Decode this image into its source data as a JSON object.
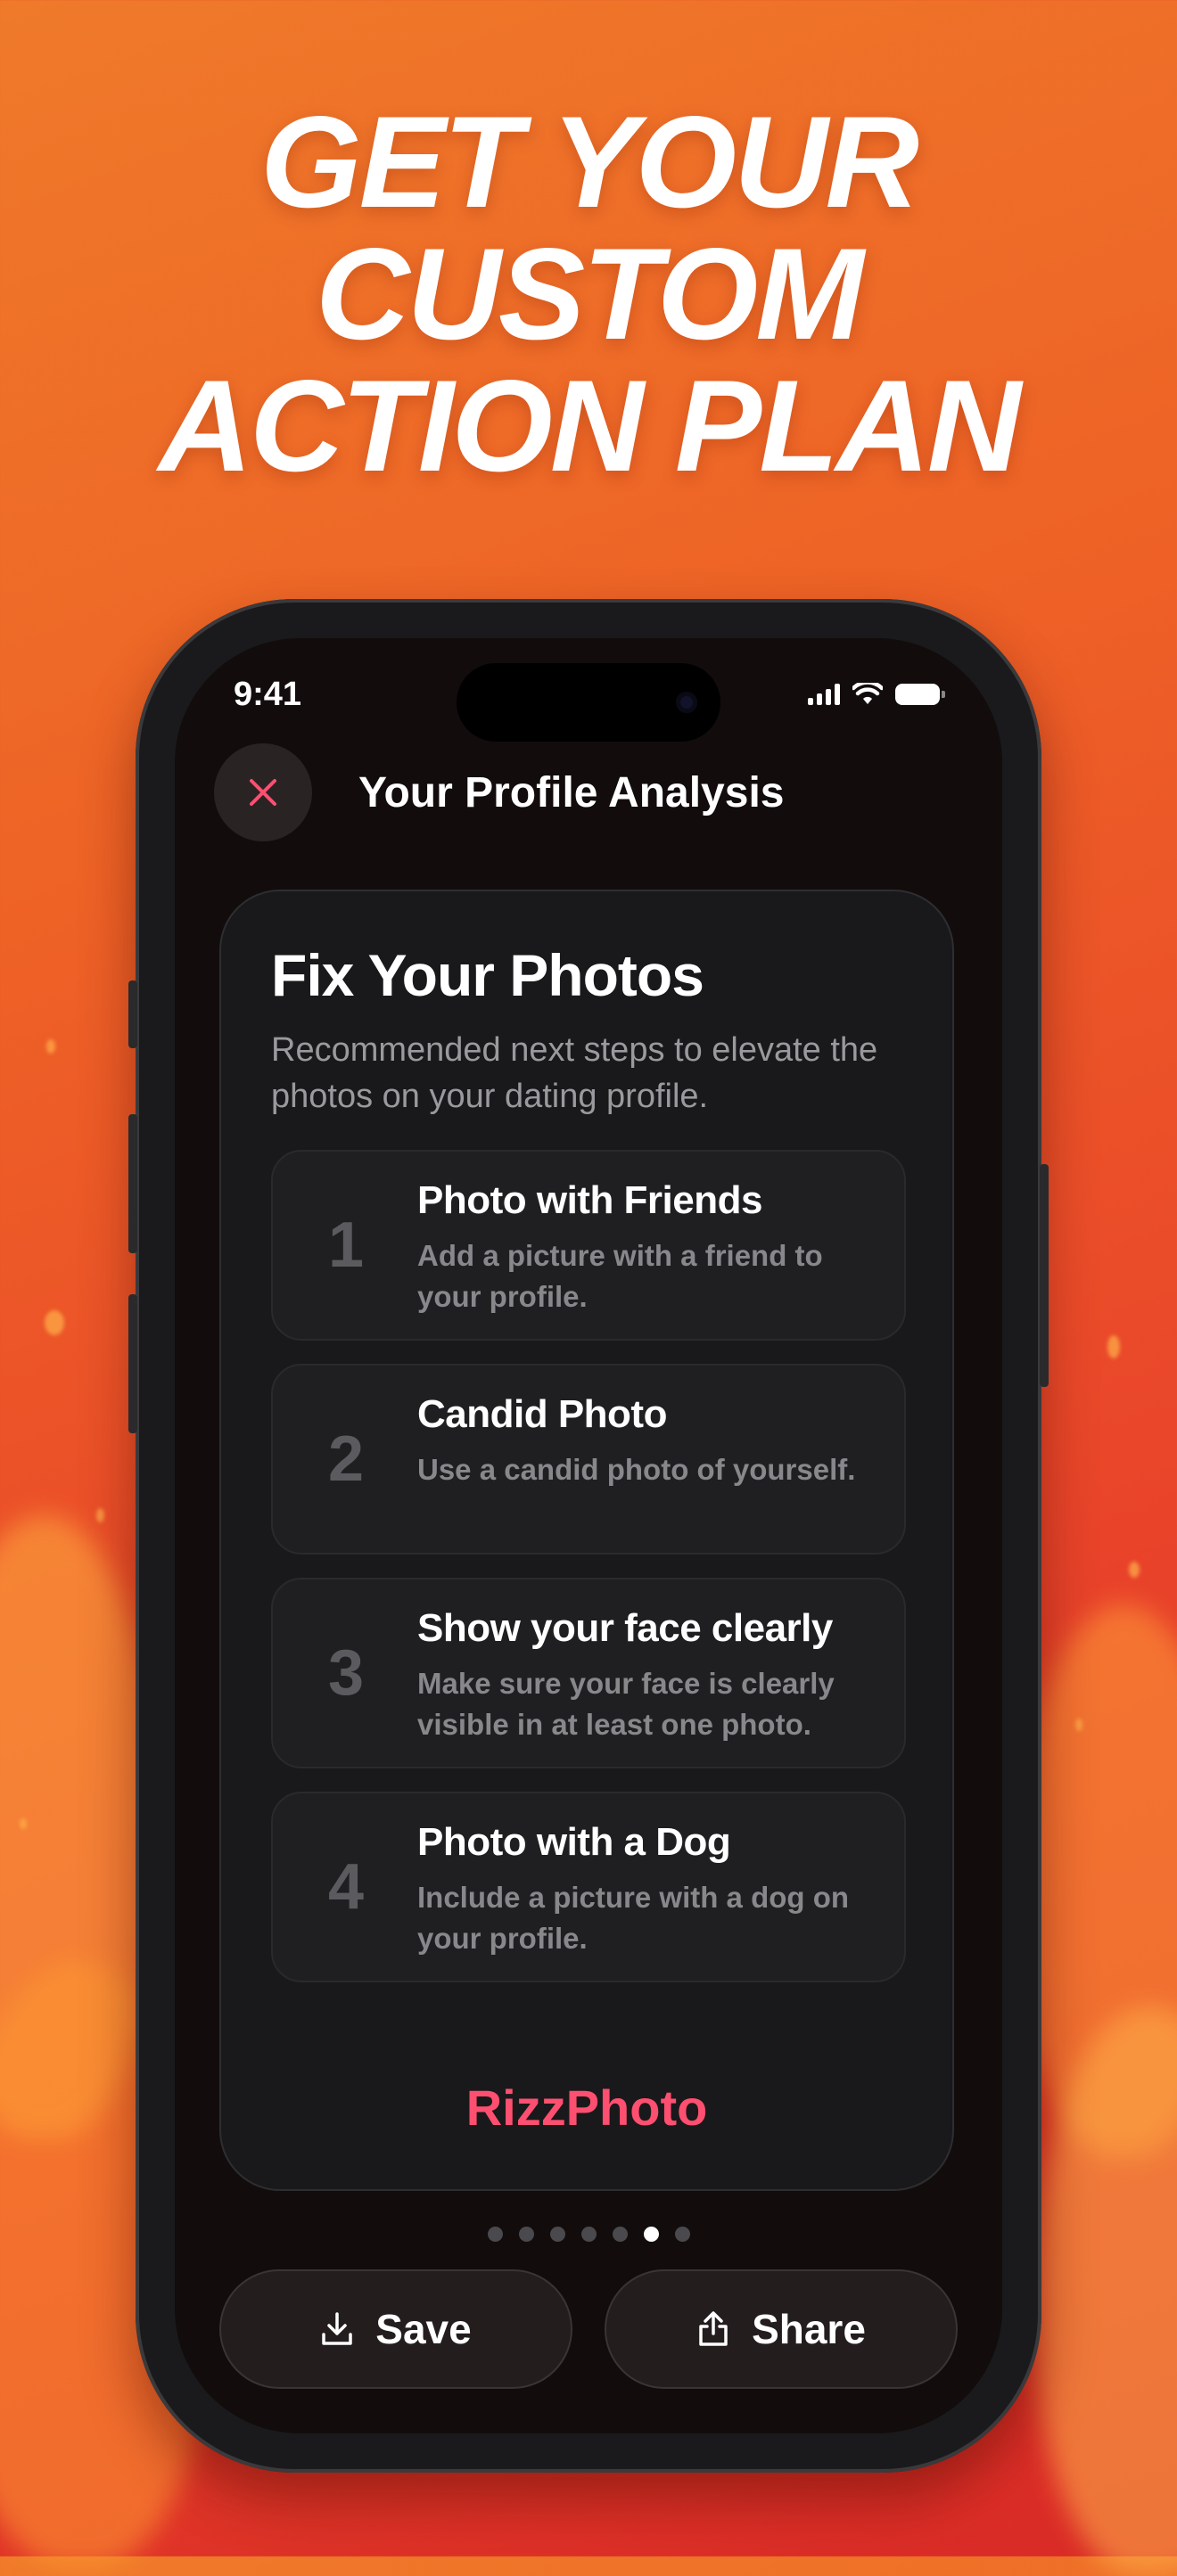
{
  "headline": {
    "line1": "GET YOUR",
    "line2": "CUSTOM",
    "line3": "ACTION PLAN"
  },
  "status_bar": {
    "time": "9:41"
  },
  "nav": {
    "title": "Your Profile Analysis",
    "close_icon": "close-icon"
  },
  "card": {
    "title": "Fix Your Photos",
    "subtitle": "Recommended next steps to elevate the photos on your dating profile.",
    "steps": [
      {
        "number": "1",
        "title": "Photo with Friends",
        "description": "Add a picture with a friend to your profile."
      },
      {
        "number": "2",
        "title": "Candid Photo",
        "description": "Use a candid photo of yourself."
      },
      {
        "number": "3",
        "title": "Show your face clearly",
        "description": "Make sure your face is clearly visible in at least one photo."
      },
      {
        "number": "4",
        "title": "Photo with a Dog",
        "description": "Include a picture with a dog on your profile."
      }
    ],
    "brand": "RizzPhoto"
  },
  "pager": {
    "count": 7,
    "active_index": 5
  },
  "actions": {
    "save_label": "Save",
    "share_label": "Share"
  },
  "colors": {
    "accent": "#ff4f70",
    "background_orange": "#ee6326",
    "screen_bg": "#120c0c"
  }
}
